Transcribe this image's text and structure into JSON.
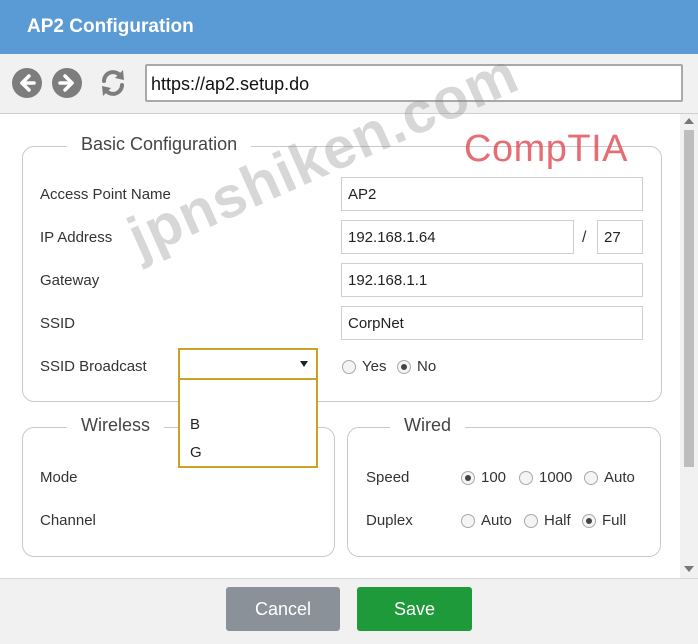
{
  "window": {
    "title": "AP2 Configuration"
  },
  "browser": {
    "url": "https://ap2.setup.do"
  },
  "basic": {
    "legend": "Basic Configuration",
    "ap_name_label": "Access Point Name",
    "ap_name_value": "AP2",
    "ip_label": "IP Address",
    "ip_value": "192.168.1.64",
    "ip_slash": "/",
    "ip_prefix": "27",
    "gateway_label": "Gateway",
    "gateway_value": "192.168.1.1",
    "ssid_label": "SSID",
    "ssid_value": "CorpNet",
    "broadcast_label": "SSID Broadcast",
    "broadcast_yes": "Yes",
    "broadcast_no": "No",
    "broadcast_selected": "No"
  },
  "wireless": {
    "legend": "Wireless",
    "mode_label": "Mode",
    "mode_value": "",
    "mode_options": [
      "B",
      "G"
    ],
    "channel_label": "Channel"
  },
  "wired": {
    "legend": "Wired",
    "speed_label": "Speed",
    "speed_options": [
      "100",
      "1000",
      "Auto"
    ],
    "speed_selected": "100",
    "duplex_label": "Duplex",
    "duplex_options": [
      "Auto",
      "Half",
      "Full"
    ],
    "duplex_selected": "Full"
  },
  "footer": {
    "cancel_label": "Cancel",
    "save_label": "Save"
  },
  "watermarks": {
    "site": "jpnshiken.com",
    "brand": "CompTIA"
  },
  "colors": {
    "titlebar": "#5b9bd5",
    "save": "#1f9a3a",
    "cancel": "#8a9198",
    "dropdown_border": "#c9a227"
  }
}
